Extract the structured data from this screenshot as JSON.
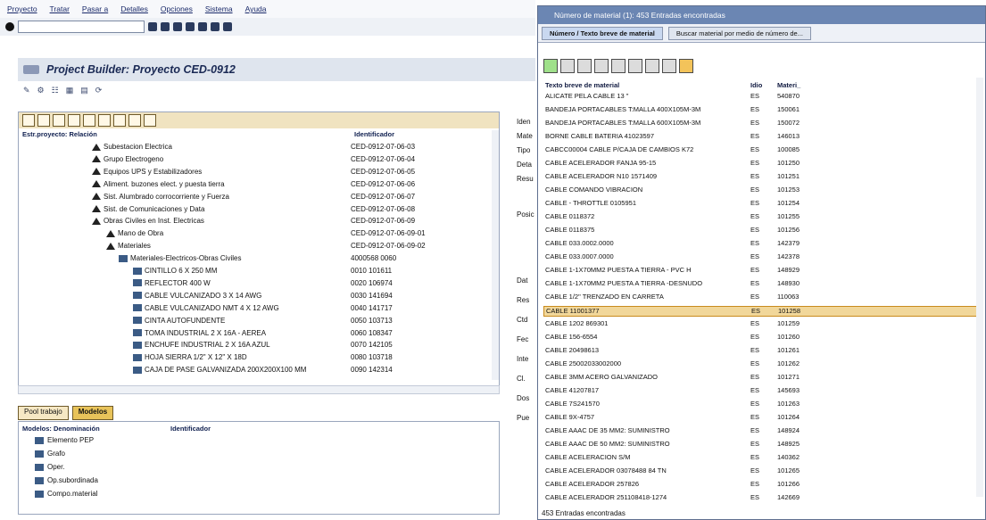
{
  "menu": [
    "Proyecto",
    "Tratar",
    "Pasar a",
    "Detalles",
    "Opciones",
    "Sistema",
    "Ayuda"
  ],
  "title": "Project Builder: Proyecto CED-0912",
  "tree": {
    "col_name": "Estr.proyecto: Relación",
    "col_id": "Identificador",
    "rows": [
      {
        "name": "Subestacion Electrica",
        "id": "CED-0912-07-06-03",
        "indent": 82,
        "icon": "triangle"
      },
      {
        "name": "Grupo Electrogeno",
        "id": "CED-0912-07-06-04",
        "indent": 82,
        "icon": "triangle"
      },
      {
        "name": "Equipos UPS y Estabilizadores",
        "id": "CED-0912-07-06-05",
        "indent": 82,
        "icon": "triangle"
      },
      {
        "name": "Aliment. buzones elect. y puesta tierra",
        "id": "CED-0912-07-06-06",
        "indent": 82,
        "icon": "triangle"
      },
      {
        "name": "Sist. Alumbrado corrocorriente y Fuerza",
        "id": "CED-0912-07-06-07",
        "indent": 82,
        "icon": "triangle"
      },
      {
        "name": "Sist. de Comunicaciones y Data",
        "id": "CED-0912-07-06-08",
        "indent": 82,
        "icon": "triangle"
      },
      {
        "name": "Obras Civiles en Inst. Electricas",
        "id": "CED-0912-07-06-09",
        "indent": 82,
        "icon": "triangle"
      },
      {
        "name": "Mano de Obra",
        "id": "CED-0912-07-06-09-01",
        "indent": 98,
        "icon": "triangle"
      },
      {
        "name": "Materiales",
        "id": "CED-0912-07-06-09-02",
        "indent": 98,
        "icon": "triangle"
      },
      {
        "name": "Materiales-Electricos-Obras Civiles",
        "id": "4000568 0060",
        "indent": 112,
        "icon": "folder"
      },
      {
        "name": "CINTILLO 6 X 250 MM",
        "id": "0010 101611",
        "indent": 128,
        "icon": "folder"
      },
      {
        "name": "REFLECTOR 400 W",
        "id": "0020 106974",
        "indent": 128,
        "icon": "folder"
      },
      {
        "name": "CABLE VULCANIZADO 3 X 14 AWG",
        "id": "0030 141694",
        "indent": 128,
        "icon": "folder"
      },
      {
        "name": "CABLE VULCANIZADO NMT 4 X 12 AWG",
        "id": "0040 141717",
        "indent": 128,
        "icon": "folder"
      },
      {
        "name": "CINTA AUTOFUNDENTE",
        "id": "0050 103713",
        "indent": 128,
        "icon": "folder"
      },
      {
        "name": "TOMA INDUSTRIAL 2 X 16A - AEREA",
        "id": "0060 108347",
        "indent": 128,
        "icon": "folder"
      },
      {
        "name": "ENCHUFE INDUSTRIAL 2 X 16A AZUL",
        "id": "0070 142105",
        "indent": 128,
        "icon": "folder"
      },
      {
        "name": "HOJA SIERRA 1/2\" X 12\" X 18D",
        "id": "0080 103718",
        "indent": 128,
        "icon": "folder"
      },
      {
        "name": "CAJA DE PASE GALVANIZADA 200X200X100 MM",
        "id": "0090 142314",
        "indent": 128,
        "icon": "folder"
      }
    ]
  },
  "worklist": {
    "tabs": [
      "Pool trabajo",
      "Modelos"
    ],
    "col_name": "Modelos: Denominación",
    "col_id": "Identificador",
    "rows": [
      "Elemento PEP",
      "Grafo",
      "Oper.",
      "Op.subordinada",
      "Compo.material"
    ]
  },
  "right_labels": [
    "Iden",
    "Mate",
    "Tipo",
    "Deta",
    "Resu",
    "Posic",
    "Dat",
    "Res",
    "Ctd",
    "Fec",
    "Inte",
    "Cl.",
    "Dos",
    "Pue"
  ],
  "popup": {
    "title": "Número de material (1): 453 Entradas encontradas",
    "tabs": [
      "Número / Texto breve de material",
      "Buscar material por medio de número de..."
    ],
    "headers": {
      "desc": "Texto breve de material",
      "lang": "Idio",
      "mat": "Materi_"
    },
    "selected_index": 21,
    "rows": [
      [
        "ALICATE PELA CABLE 13 \"",
        "ES",
        "540870"
      ],
      [
        "BANDEJA PORTACABLES T:MALLA 400X105M-3M",
        "ES",
        "150061"
      ],
      [
        "BANDEJA PORTACABLES T:MALLA 600X105M-3M",
        "ES",
        "150072"
      ],
      [
        "BORNE CABLE BATERIA 41023597",
        "ES",
        "146013"
      ],
      [
        "CABCC00004 CABLE P/CAJA DE CAMBIOS K72",
        "ES",
        "100085"
      ],
      [
        "CABLE ACELERADOR FANJA 95-15",
        "ES",
        "101250"
      ],
      [
        "CABLE ACELERADOR N10 1571409",
        "ES",
        "101251"
      ],
      [
        "CABLE COMANDO VIBRACION",
        "ES",
        "101253"
      ],
      [
        "CABLE - THROTTLE 0105951",
        "ES",
        "101254"
      ],
      [
        "CABLE 0118372",
        "ES",
        "101255"
      ],
      [
        "CABLE 0118375",
        "ES",
        "101256"
      ],
      [
        "CABLE 033.0002.0000",
        "ES",
        "142379"
      ],
      [
        "CABLE 033.0007.0000",
        "ES",
        "142378"
      ],
      [
        "CABLE 1-1X70MM2 PUESTA A TIERRA - PVC H",
        "ES",
        "148929"
      ],
      [
        "CABLE 1-1X70MM2 PUESTA A TIERRA -DESNUDO",
        "ES",
        "148930"
      ],
      [
        "CABLE 1/2\" TRENZADO EN CARRETA",
        "ES",
        "110063"
      ],
      [
        "CABLE 11001377",
        "ES",
        "101258"
      ],
      [
        "CABLE 1202 869301",
        "ES",
        "101259"
      ],
      [
        "CABLE 156-6554",
        "ES",
        "101260"
      ],
      [
        "CABLE 20498613",
        "ES",
        "101261"
      ],
      [
        "CABLE 25002033002000",
        "ES",
        "101262"
      ],
      [
        "CABLE 3MM ACERO GALVANIZADO",
        "ES",
        "101271"
      ],
      [
        "CABLE 41207817",
        "ES",
        "145693"
      ],
      [
        "CABLE 7S241570",
        "ES",
        "101263"
      ],
      [
        "CABLE 9X-4757",
        "ES",
        "101264"
      ],
      [
        "CABLE AAAC DE 35 MM2: SUMINISTRO",
        "ES",
        "148924"
      ],
      [
        "CABLE AAAC DE 50 MM2: SUMINISTRO",
        "ES",
        "148925"
      ],
      [
        "CABLE ACELERACION S/M",
        "ES",
        "140362"
      ],
      [
        "CABLE ACELERADOR 03078488 84 TN",
        "ES",
        "101265"
      ],
      [
        "CABLE ACELERADOR 257826",
        "ES",
        "101266"
      ],
      [
        "CABLE ACELERADOR 251108418-1274",
        "ES",
        "142669"
      ]
    ],
    "status": "453 Entradas encontradas"
  }
}
